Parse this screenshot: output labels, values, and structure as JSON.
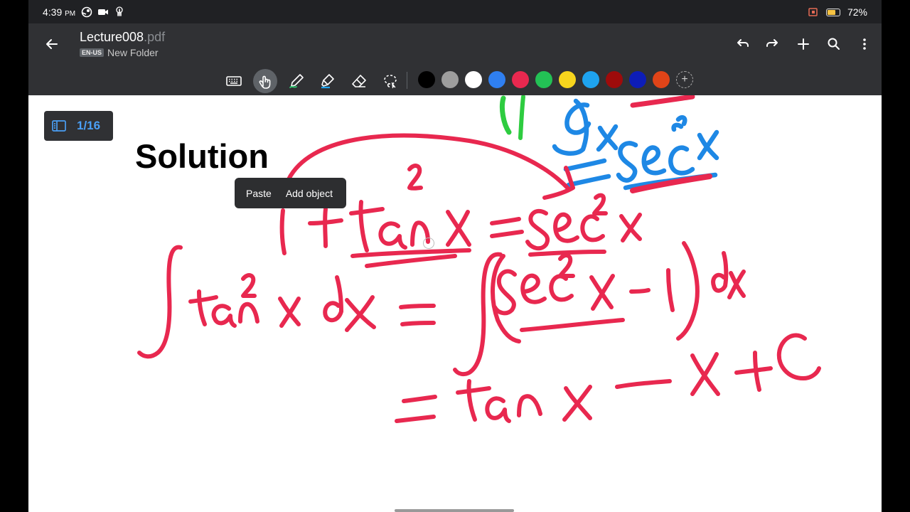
{
  "status_bar": {
    "time": "4:39",
    "ampm": "PM",
    "battery_text": "72%",
    "battery_level": 0.72
  },
  "app_bar": {
    "title": "Lecture008",
    "title_ext": ".pdf",
    "lang_badge": "EN-US",
    "folder": "New Folder",
    "actions": [
      "undo-icon",
      "redo-icon",
      "add-icon",
      "search-icon",
      "more-icon"
    ]
  },
  "toolbar": {
    "tools": [
      "keyboard-icon",
      "touch-icon",
      "pen-icon",
      "highlighter-icon",
      "eraser-icon",
      "lasso-icon"
    ],
    "active_tool": "touch-icon",
    "colors": [
      "#000000",
      "#9e9e9e",
      "#ffffff",
      "#2f7ff0",
      "#e8284f",
      "#23c155",
      "#f7d51d",
      "#1ea3ef",
      "#9e0b0b",
      "#0d1db8",
      "#e04418"
    ]
  },
  "page": {
    "indicator": "1/16",
    "heading": "Solution"
  },
  "context_menu": {
    "paste": "Paste",
    "add_object": "Add object"
  },
  "ink_colors": {
    "red": "#e8284f",
    "blue": "#1e88e5",
    "green": "#2ecc40"
  }
}
